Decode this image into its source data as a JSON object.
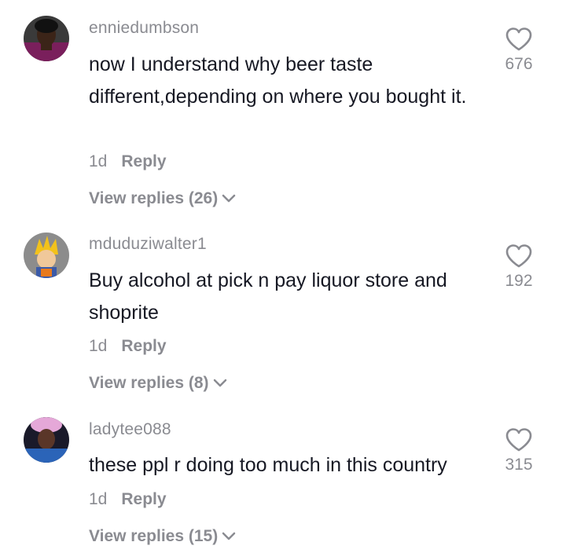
{
  "comments": [
    {
      "username": "enniedumbson",
      "text": "now I understand why beer taste different,depending on where you bought it.",
      "time": "1d",
      "reply_label": "Reply",
      "view_replies": "View replies (26)",
      "likes": "676",
      "avatar_icon": "user-avatar-photo",
      "heart_icon": "heart-outline-icon",
      "chevron_icon": "chevron-down-icon"
    },
    {
      "username": "mduduziwalter1",
      "text": "Buy alcohol at pick n pay liquor store and shoprite",
      "time": "1d",
      "reply_label": "Reply",
      "view_replies": "View replies (8)",
      "likes": "192",
      "avatar_icon": "cartoon-character-avatar",
      "heart_icon": "heart-outline-icon",
      "chevron_icon": "chevron-down-icon"
    },
    {
      "username": "ladytee088",
      "text": "these ppl r doing too much in this country",
      "time": "1d",
      "reply_label": "Reply",
      "view_replies": "View replies (15)",
      "likes": "315",
      "avatar_icon": "user-avatar-photo",
      "heart_icon": "heart-outline-icon",
      "chevron_icon": "chevron-down-icon"
    }
  ],
  "colors": {
    "text_primary": "#161823",
    "text_secondary": "#8a8b91",
    "background": "#ffffff"
  }
}
